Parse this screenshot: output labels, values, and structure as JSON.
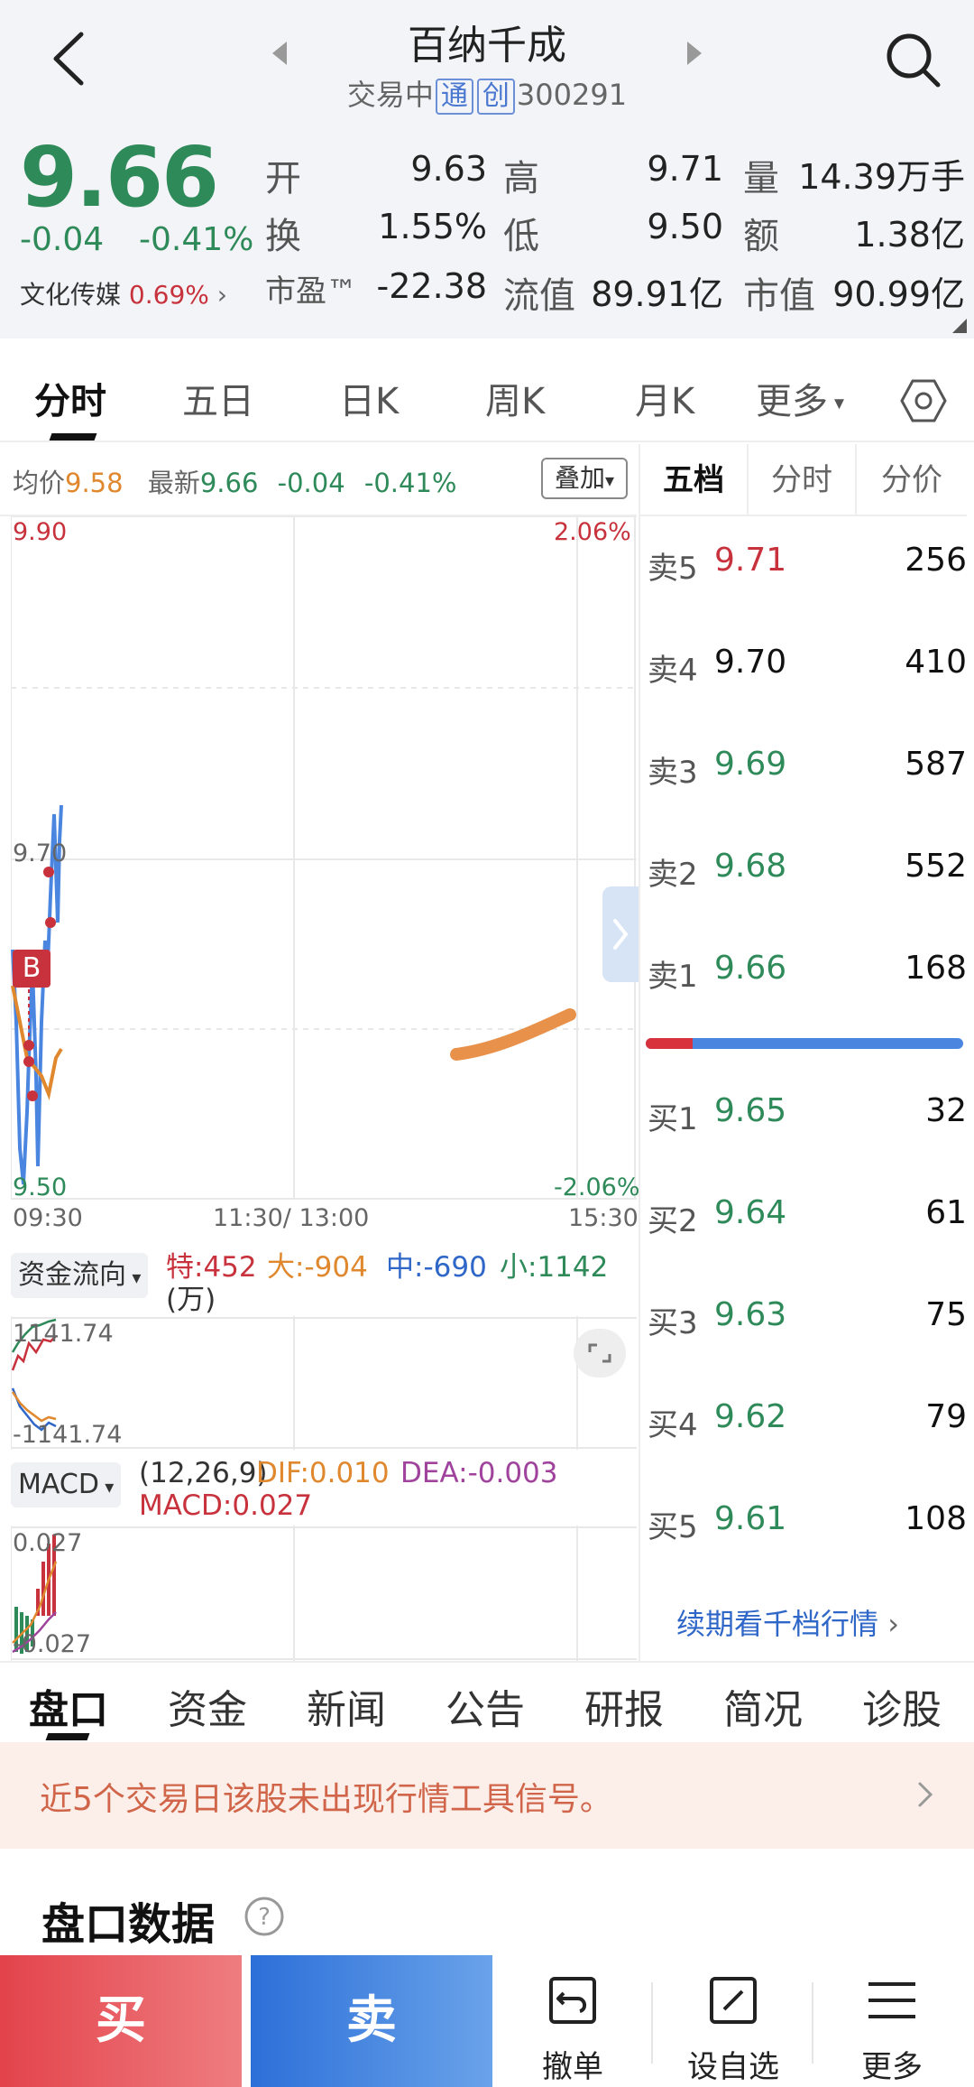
{
  "header": {
    "title": "百纳千成",
    "market": "交易中",
    "tag1": "通",
    "tag2": "创",
    "code": "300291"
  },
  "quote": {
    "price": "9.66",
    "change": "-0.04",
    "change_pct": "-0.41%",
    "sector_name": "文化传媒",
    "sector_pct": "0.69%",
    "open_label": "开",
    "open": "9.63",
    "high_label": "高",
    "high": "9.71",
    "volume_label": "量",
    "volume": "14.39万手",
    "turnover_label": "换",
    "turnover": "1.55%",
    "low_label": "低",
    "low": "9.50",
    "amount_label": "额",
    "amount": "1.38亿",
    "pe_label": "市盈™",
    "pe": "-22.38",
    "float_cap_label": "流值",
    "float_cap": "89.91亿",
    "market_cap_label": "市值",
    "market_cap": "90.99亿"
  },
  "chart_tabs": [
    "分时",
    "五日",
    "日K",
    "周K",
    "月K",
    "更多"
  ],
  "info_strip": {
    "avg_label": "均价",
    "avg": "9.58",
    "latest_label": "最新",
    "latest": "9.66",
    "chg": "-0.04",
    "chg_pct": "-0.41%",
    "overlay_label": "叠加"
  },
  "chart": {
    "y_max": "9.90",
    "y_mid": "9.70",
    "y_min": "9.50",
    "pct_max": "2.06%",
    "pct_min": "-2.06%",
    "t_start": "09:30",
    "t_mid": "11:30/ 13:00",
    "t_end": "15:30",
    "b_marker": "B"
  },
  "fund_flow": {
    "dropdown": "资金流向",
    "special_label": "特:",
    "special": "452",
    "large_label": "大:",
    "large": "-904",
    "medium_label": "中:",
    "medium": "-690",
    "small_label": "小:",
    "small": "1142",
    "unit": "(万)",
    "axis_top": "1141.74",
    "axis_bottom": "-1141.74"
  },
  "macd": {
    "dropdown": "MACD",
    "params": "(12,26,9)",
    "dif": "DIF:0.010",
    "dea": "DEA:-0.003",
    "macd": "MACD:0.027",
    "axis_top": "0.027",
    "axis_bottom": "-0.027"
  },
  "order_book": {
    "tabs": [
      "五档",
      "分时",
      "分价"
    ],
    "asks": [
      {
        "label": "卖5",
        "price": "9.71",
        "vol": "256"
      },
      {
        "label": "卖4",
        "price": "9.70",
        "vol": "410"
      },
      {
        "label": "卖3",
        "price": "9.69",
        "vol": "587"
      },
      {
        "label": "卖2",
        "price": "9.68",
        "vol": "552"
      },
      {
        "label": "卖1",
        "price": "9.66",
        "vol": "168"
      }
    ],
    "bids": [
      {
        "label": "买1",
        "price": "9.65",
        "vol": "32"
      },
      {
        "label": "买2",
        "price": "9.64",
        "vol": "61"
      },
      {
        "label": "买3",
        "price": "9.63",
        "vol": "75"
      },
      {
        "label": "买4",
        "price": "9.62",
        "vol": "79"
      },
      {
        "label": "买5",
        "price": "9.61",
        "vol": "108"
      }
    ],
    "more_link": "续期看千档行情"
  },
  "bottom_tabs": [
    "盘口",
    "资金",
    "新闻",
    "公告",
    "研报",
    "简况",
    "诊股"
  ],
  "signal": {
    "text": "近5个交易日该股未出现行情工具信号。"
  },
  "section": {
    "title": "盘口数据"
  },
  "actions": {
    "buy": "买",
    "sell": "卖",
    "cancel": "撤单",
    "watchlist": "设自选",
    "more": "更多"
  },
  "colors": {
    "up": "#c8323c",
    "down": "#2f8a5a",
    "avg_line": "#e0882e",
    "price_line": "#4a86e0",
    "buy_btn": "#e3434b",
    "sell_btn": "#2c6fd8"
  }
}
